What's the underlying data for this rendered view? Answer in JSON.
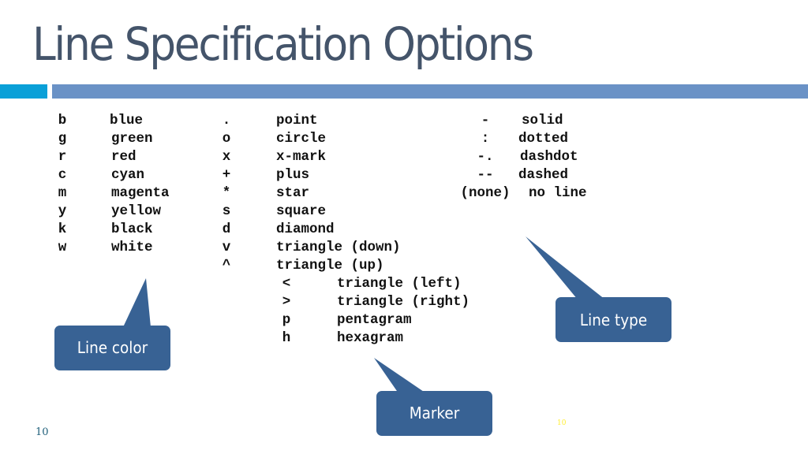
{
  "title": "Line Specification Options",
  "colors": {
    "title": "#44546a",
    "accent_bar": "#0aa0d8",
    "main_bar": "#6a92c6",
    "callout_fill": "#386294",
    "callout_text": "#ffffff",
    "page_number": "#1f5f7a",
    "page_number_secondary": "#ffee33"
  },
  "line_colors": [
    {
      "code": "b",
      "name": "blue"
    },
    {
      "code": "g",
      "name": "green"
    },
    {
      "code": "r",
      "name": "red"
    },
    {
      "code": "c",
      "name": "cyan"
    },
    {
      "code": "m",
      "name": "magenta"
    },
    {
      "code": "y",
      "name": "yellow"
    },
    {
      "code": "k",
      "name": "black"
    },
    {
      "code": "w",
      "name": "white"
    }
  ],
  "markers": [
    {
      "code": ".",
      "name": "point"
    },
    {
      "code": "o",
      "name": "circle"
    },
    {
      "code": "x",
      "name": "x-mark"
    },
    {
      "code": "+",
      "name": "plus"
    },
    {
      "code": "*",
      "name": "star"
    },
    {
      "code": "s",
      "name": "square"
    },
    {
      "code": "d",
      "name": "diamond"
    },
    {
      "code": "v",
      "name": "triangle (down)"
    },
    {
      "code": "^",
      "name": "triangle (up)"
    },
    {
      "code": "<",
      "name": "triangle (left)"
    },
    {
      "code": ">",
      "name": "triangle (right)"
    },
    {
      "code": "p",
      "name": "pentagram"
    },
    {
      "code": "h",
      "name": "hexagram"
    }
  ],
  "line_types": [
    {
      "code": "-",
      "name": "solid"
    },
    {
      "code": ":",
      "name": "dotted"
    },
    {
      "code": "-.",
      "name": "dashdot"
    },
    {
      "code": "--",
      "name": "dashed"
    },
    {
      "code": "(none)",
      "name": "no line"
    }
  ],
  "callouts": {
    "line_color": "Line color",
    "marker": "Marker",
    "line_type": "Line type"
  },
  "page_number": "10",
  "page_number_secondary": "10"
}
